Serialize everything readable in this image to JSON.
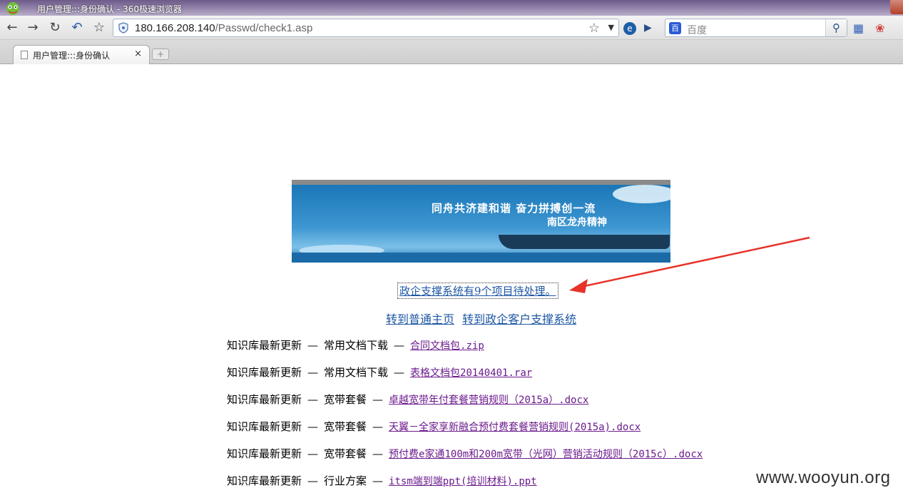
{
  "window": {
    "title": "用户管理:::身份确认 - 360极速浏览器"
  },
  "toolbar": {
    "url_host": "180.166.208.140",
    "url_path": "/Passwd/check1.asp",
    "search_placeholder": "百度"
  },
  "tabs": [
    {
      "label": "用户管理:::身份确认",
      "close": "×"
    }
  ],
  "banner": {
    "slogan": "同舟共济建和谐 奋力拼搏创一流",
    "subtitle": "南区龙舟精神"
  },
  "notice": "政企支撑系统有9个项目待处理。",
  "links": [
    {
      "label": "转到普通主页"
    },
    {
      "label": "转到政企客户支撑系统"
    }
  ],
  "updates": [
    {
      "prefix": "知识库最新更新",
      "category": "常用文档下载",
      "file": "合同文档包.zip"
    },
    {
      "prefix": "知识库最新更新",
      "category": "常用文档下载",
      "file": "表格文档包20140401.rar"
    },
    {
      "prefix": "知识库最新更新",
      "category": "宽带套餐",
      "file": "卓越宽带年付套餐营销规则（2015a）.docx"
    },
    {
      "prefix": "知识库最新更新",
      "category": "宽带套餐",
      "file": "天翼－全家享新融合预付费套餐营销规则(2015a).docx"
    },
    {
      "prefix": "知识库最新更新",
      "category": "宽带套餐",
      "file": "预付费e家通100m和200m宽带（光网）营销活动规则（2015c）.docx"
    },
    {
      "prefix": "知识库最新更新",
      "category": "行业方案",
      "file": "itsm端到端ppt(培训材料).ppt"
    }
  ],
  "separator": "—",
  "watermark": "www.wooyun.org"
}
